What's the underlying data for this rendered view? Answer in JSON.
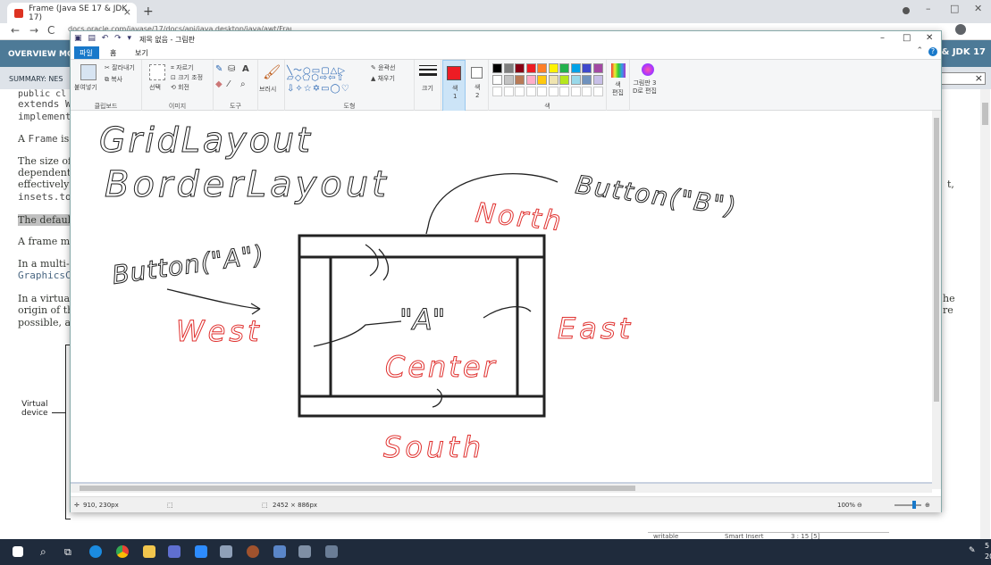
{
  "browser": {
    "tab_title": "Frame (Java SE 17 & JDK 17)",
    "tab_close": "×",
    "new_tab": "+",
    "url": "docs.oracle.com/javase/17/docs/api/java.desktop/java/awt/Frame.html",
    "nav_back": "←",
    "nav_forward": "→",
    "nav_reload": "C",
    "win_min": "–",
    "win_max": "□",
    "win_close": "✕"
  },
  "javadoc": {
    "nav_overview": "OVERVIEW",
    "nav_module": "MO",
    "nav_jdk": "& JDK 17",
    "subnav": "SUMMARY: NES",
    "search_clear": "×",
    "line_extends": "extends W",
    "line_implements": "implement",
    "line_frame_prefix": "A ",
    "line_frame_code": "Frame",
    "line_frame_suffix": " is",
    "line_size1": "The size of",
    "line_size2": "dependent,",
    "line_size3": "effectively",
    "line_insets": "insets.top",
    "line_default": "The defaul",
    "line_frame_may": "A frame ma",
    "line_multi": "In a multi-s",
    "line_graphics": "GraphicsC",
    "line_virtual": "In a virtual",
    "line_origin": "origin of th",
    "line_possible": "possible, as",
    "right_t": "t,",
    "right_he": "he",
    "right_re": "re",
    "virtual_device": "Virtual\ndevice",
    "bottom_cells": [
      "writable",
      "Smart Insert",
      "3 : 15 [5]"
    ]
  },
  "paint": {
    "title": "제목 없음 - 그림판",
    "tabs": [
      "파일",
      "홈",
      "보기"
    ],
    "groups": {
      "clipboard": {
        "label": "클립보드",
        "paste": "붙여넣기",
        "cut": "잘라내기",
        "copy": "복사"
      },
      "image": {
        "label": "이미지",
        "select": "선택",
        "crop": "자르기",
        "resize": "크기 조정",
        "rotate": "회전"
      },
      "tools": {
        "label": "도구"
      },
      "brushes": {
        "label": "브러시"
      },
      "shapes": {
        "label": "도형",
        "outline": "윤곽선",
        "fill": "채우기"
      },
      "size": {
        "label": "크기"
      },
      "color1": {
        "label": "색\n1"
      },
      "color2": {
        "label": "색\n2"
      },
      "colors": {
        "label": "색"
      },
      "edit_colors": {
        "label": "색\n편집"
      },
      "paint3d": {
        "label": "그림판 3\nD로 편집"
      }
    },
    "palette": [
      "#000000",
      "#7f7f7f",
      "#880015",
      "#ed1c24",
      "#ff7f27",
      "#fff200",
      "#22b14c",
      "#00a2e8",
      "#3f48cc",
      "#a349a4",
      "#ffffff",
      "#c3c3c3",
      "#b97a57",
      "#ffaec9",
      "#ffc90e",
      "#efe4b0",
      "#b5e61d",
      "#99d9ea",
      "#7092be",
      "#c8bfe7"
    ],
    "active_color": "#ed1c24",
    "status": {
      "cursor_pos": "910, 230px",
      "image_size": "2452 × 886px",
      "zoom": "100%"
    },
    "drawing": {
      "title1": "GridLayout",
      "title2": "BorderLayout",
      "button_b": "Button(\"B\")",
      "button_a": "Button(\"A\")",
      "north": "North",
      "west": "West",
      "east": "East",
      "center": "Center",
      "south": "South",
      "quote_a": "\"A\""
    }
  },
  "taskbar": {
    "clock_time": "5",
    "clock_date": "20"
  }
}
